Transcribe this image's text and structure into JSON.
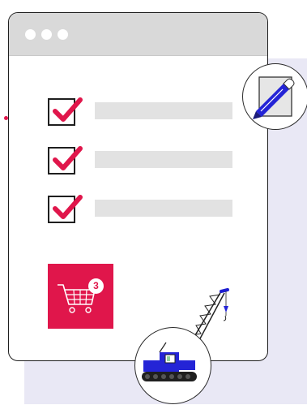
{
  "window": {
    "controls": [
      "dot-1",
      "dot-2",
      "dot-3"
    ]
  },
  "checklist": {
    "items": [
      {
        "checked": true
      },
      {
        "checked": true
      },
      {
        "checked": true
      }
    ]
  },
  "cart": {
    "icon": "shopping-cart-icon",
    "count": "3"
  },
  "icons": {
    "pen": "pen-on-paper-icon",
    "crane": "crawler-crane-icon"
  },
  "colors": {
    "accent": "#e0164b",
    "background_panel": "#e9e8f5",
    "titlebar": "#d9d9d9",
    "bar": "#e2e2e2",
    "pen": "#2424d6"
  }
}
